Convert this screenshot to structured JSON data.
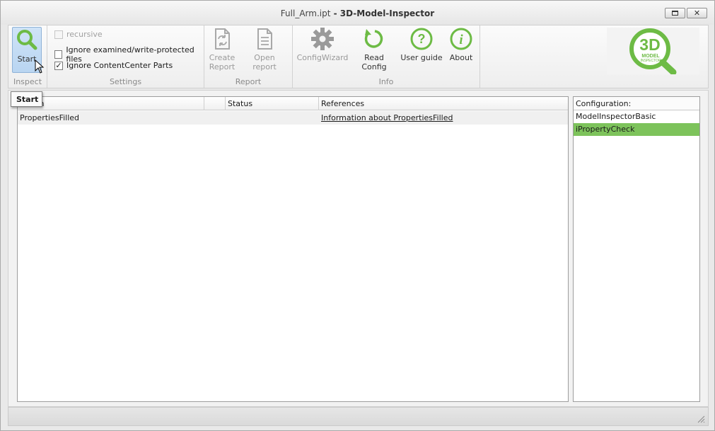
{
  "window": {
    "file_name": "Full_Arm.ipt",
    "separator": " - ",
    "app_name": "3D-Model-Inspector",
    "close_glyph": "✕"
  },
  "ribbon": {
    "inspect": {
      "group_label": "Inspect",
      "start_label": "Start"
    },
    "settings": {
      "group_label": "Settings",
      "options": [
        {
          "label": "recursive",
          "checked": false,
          "enabled": false
        },
        {
          "label": "Ignore examined/write-protected files",
          "checked": false,
          "enabled": true
        },
        {
          "label": "Ignore ContentCenter Parts",
          "checked": true,
          "enabled": true
        }
      ],
      "check_glyph": "✓"
    },
    "report": {
      "group_label": "Report",
      "create_line1": "Create",
      "create_line2": "Report",
      "open_label": "Open report"
    },
    "info": {
      "group_label": "Info",
      "configwizard_label": "ConfigWizard",
      "readconfig_label": "Read Config",
      "userguide_label": "User guide",
      "about_label": "About"
    },
    "logo": {
      "big_text": "3D",
      "line1": "MODEL",
      "line2": "INSPECTOR"
    }
  },
  "grid": {
    "columns": [
      {
        "label": "Action"
      },
      {
        "label": ""
      },
      {
        "label": "Status"
      },
      {
        "label": "References"
      }
    ],
    "rows": [
      {
        "action": "PropertiesFilled",
        "status": "",
        "reference": "Information about PropertiesFilled"
      }
    ]
  },
  "config": {
    "header": "Configuration:",
    "items": [
      {
        "label": "ModelInspectorBasic",
        "selected": false
      },
      {
        "label": "iPropertyCheck",
        "selected": true
      }
    ]
  },
  "tooltip": {
    "text": "Start"
  },
  "colors": {
    "accent_green": "#6dbb45",
    "selection_green": "#7dc35b",
    "start_button_blue": "#c2dbf4"
  }
}
